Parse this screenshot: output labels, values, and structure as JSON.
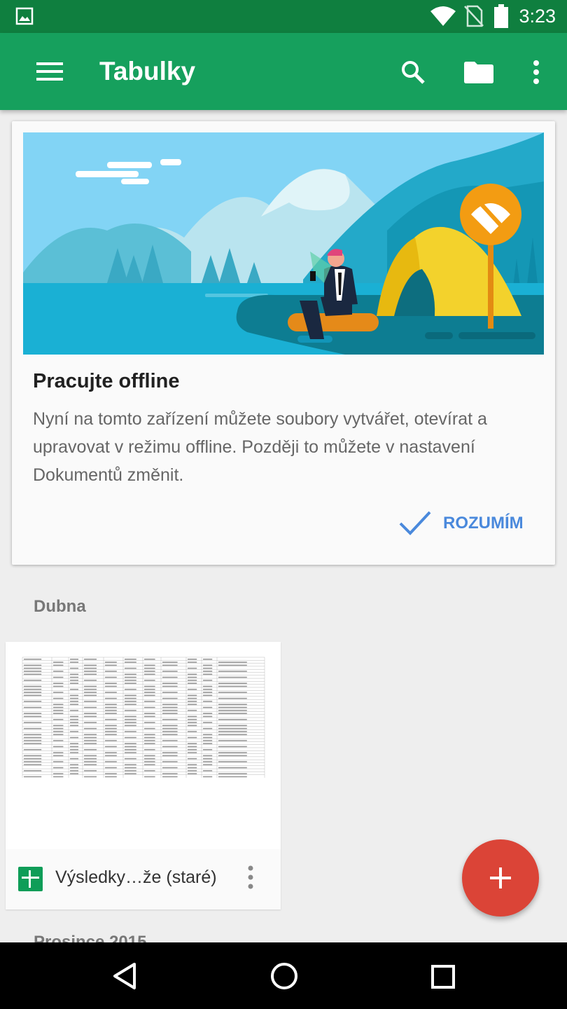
{
  "status_bar": {
    "time": "3:23"
  },
  "app_bar": {
    "title": "Tabulky"
  },
  "offline_card": {
    "title": "Pracujte offline",
    "body": "Nyní na tomto zařízení můžete soubory vytvářet, otevírat a upravovat v režimu offline. Později to můžete v nastavení Dokumentů změnit.",
    "dismiss_label": "ROZUMÍM"
  },
  "sections": [
    {
      "label": "Dubna"
    },
    {
      "label": "Prosince 2015"
    }
  ],
  "files": [
    {
      "name": "Výsledky…že (staré)",
      "type_icon": "sheets-icon"
    }
  ],
  "colors": {
    "status_bar": "#0f7f3f",
    "app_bar": "#16a05d",
    "accent_blue": "#4a89dc",
    "fab": "#db4437",
    "sheets_green": "#0f9d58"
  }
}
